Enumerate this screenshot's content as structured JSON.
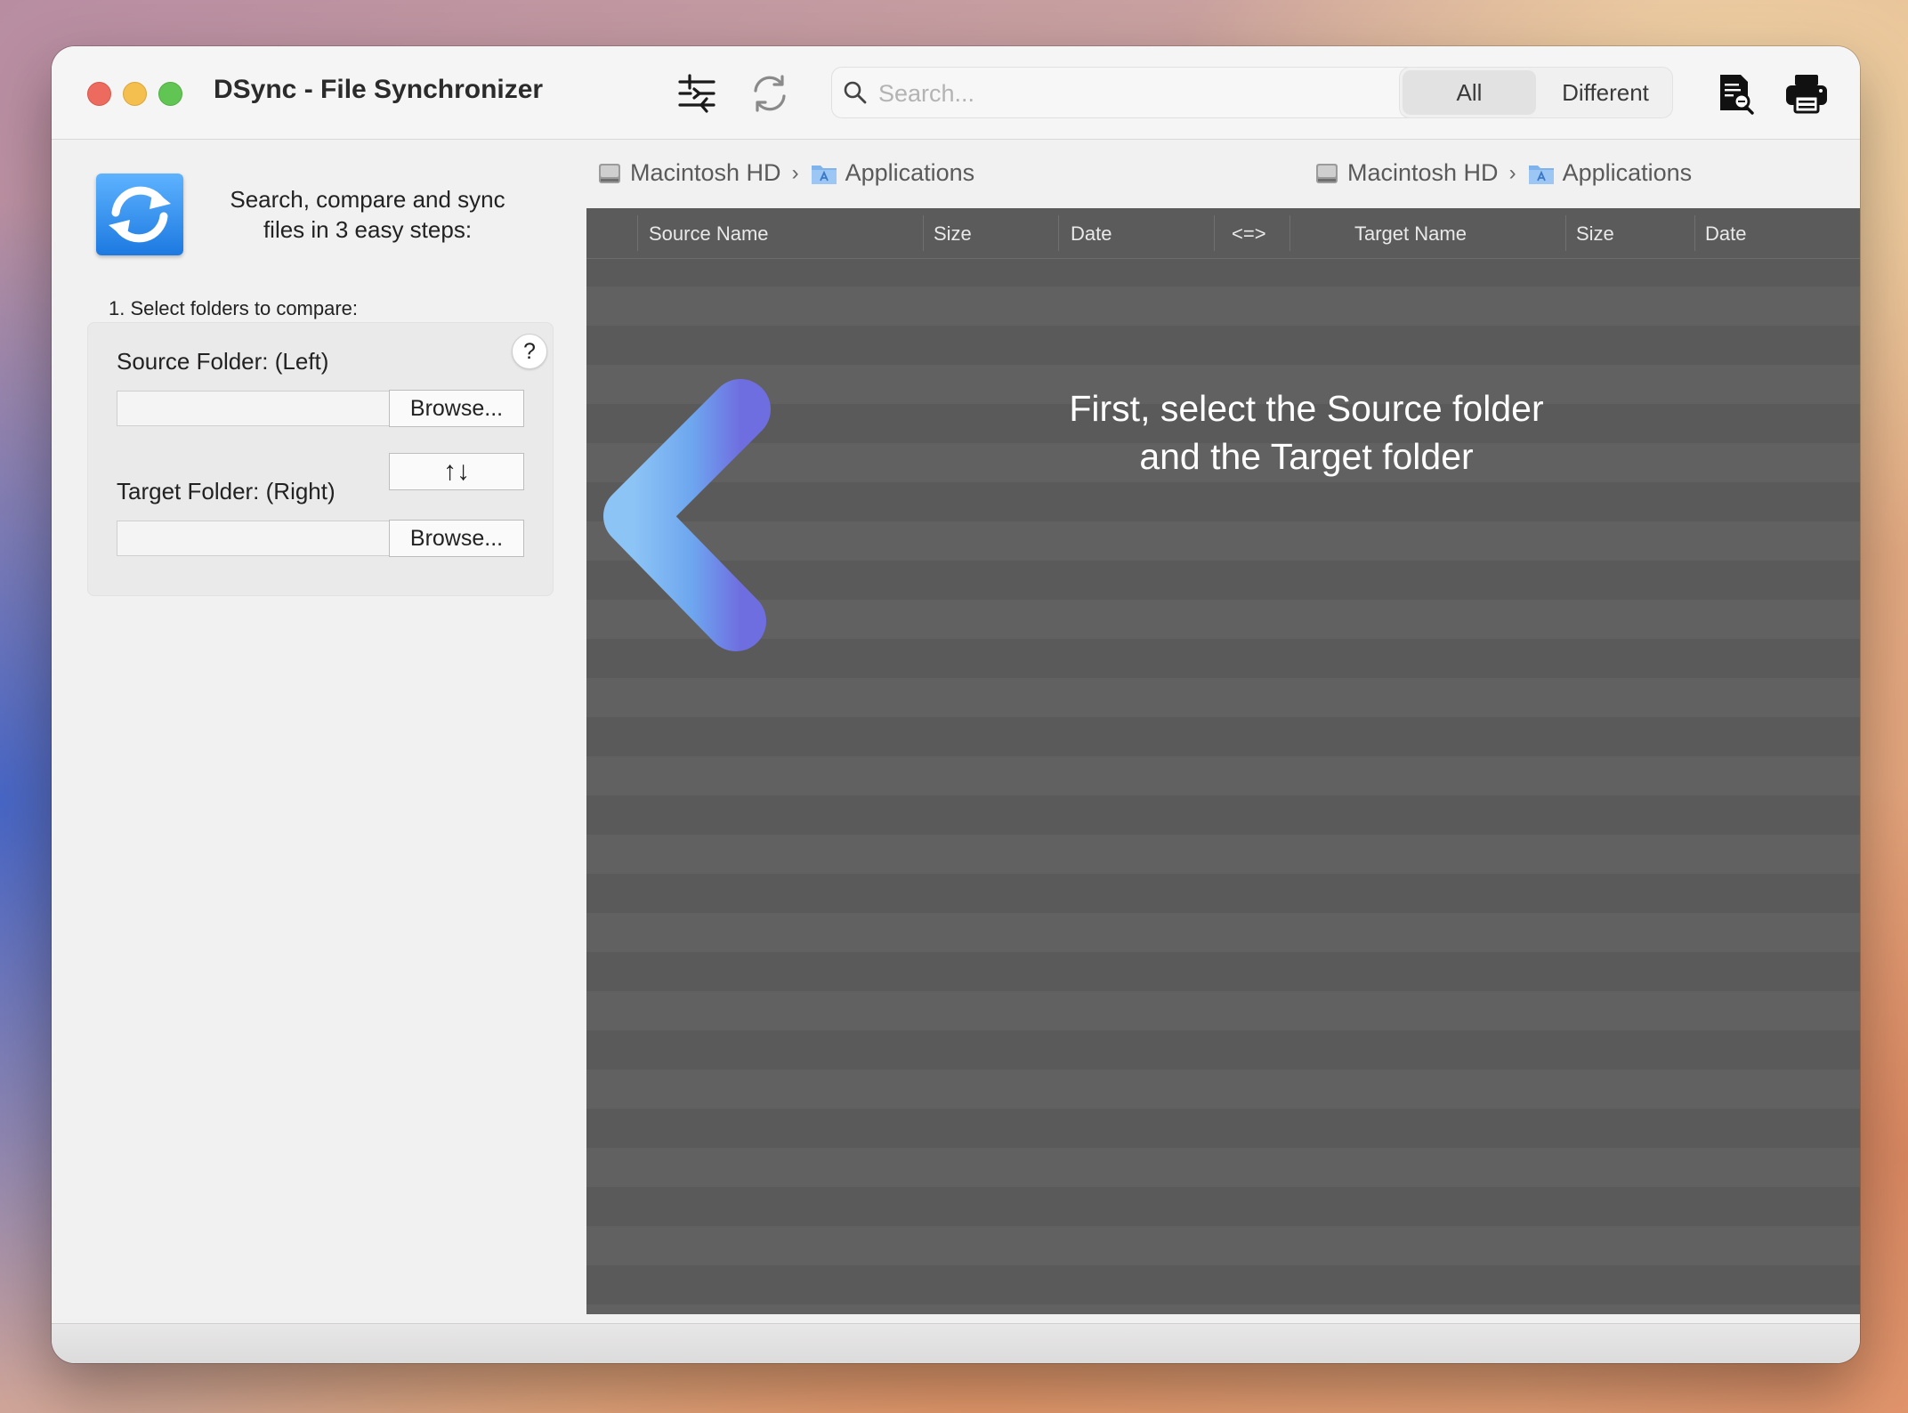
{
  "window": {
    "title": "DSync - File Synchronizer"
  },
  "toolbar": {
    "compare_icon": "compare-sliders-icon",
    "sync_icon": "refresh-icon",
    "search_placeholder": "Search...",
    "filter": {
      "options": [
        "All",
        "Different"
      ],
      "selected": "All"
    },
    "report_icon": "document-search-icon",
    "print_icon": "printer-icon"
  },
  "sidebar": {
    "intro": "Search, compare and sync files in 3 easy steps:",
    "step1": "1. Select folders to compare:",
    "help_label": "?",
    "source_label": "Source Folder: (Left)",
    "source_value": "",
    "target_label": "Target Folder: (Right)",
    "target_value": "",
    "browse_label": "Browse...",
    "swap_label": "↑↓"
  },
  "paths": {
    "left": {
      "drive": "Macintosh HD",
      "folder": "Applications"
    },
    "right": {
      "drive": "Macintosh HD",
      "folder": "Applications"
    }
  },
  "table": {
    "columns": [
      "Source Name",
      "Size",
      "Date",
      "<=>",
      "Target Name",
      "Size",
      "Date"
    ]
  },
  "overlay": {
    "line1": "First, select the Source folder",
    "line2": "and the Target folder"
  },
  "colors": {
    "accent_blue": "#1c79e0",
    "table_bg": "#616161",
    "arrow_start": "#8cc4f6",
    "arrow_end": "#6f6ee0"
  }
}
